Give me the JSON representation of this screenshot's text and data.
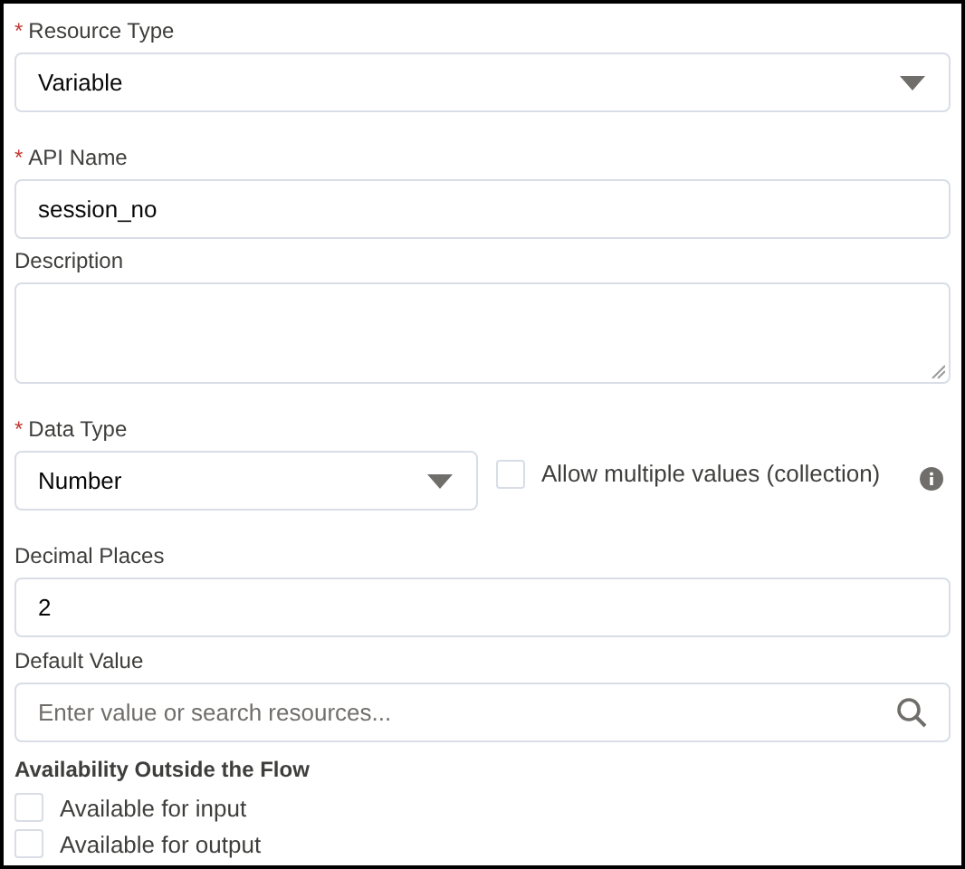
{
  "resource_type": {
    "required_mark": "*",
    "label": "Resource Type",
    "value": "Variable"
  },
  "api_name": {
    "required_mark": "*",
    "label": "API Name",
    "value": "session_no"
  },
  "description": {
    "label": "Description"
  },
  "data_type": {
    "required_mark": "*",
    "label": "Data Type",
    "value": "Number"
  },
  "allow_multiple": {
    "label": "Allow multiple values (collection)",
    "checked": false
  },
  "decimal_places": {
    "label": "Decimal Places",
    "value": "2"
  },
  "default_value": {
    "label": "Default Value",
    "placeholder": "Enter value or search resources..."
  },
  "availability": {
    "title": "Availability Outside the Flow",
    "options": [
      {
        "label": "Available for input",
        "checked": false
      },
      {
        "label": "Available for output",
        "checked": false
      }
    ]
  }
}
